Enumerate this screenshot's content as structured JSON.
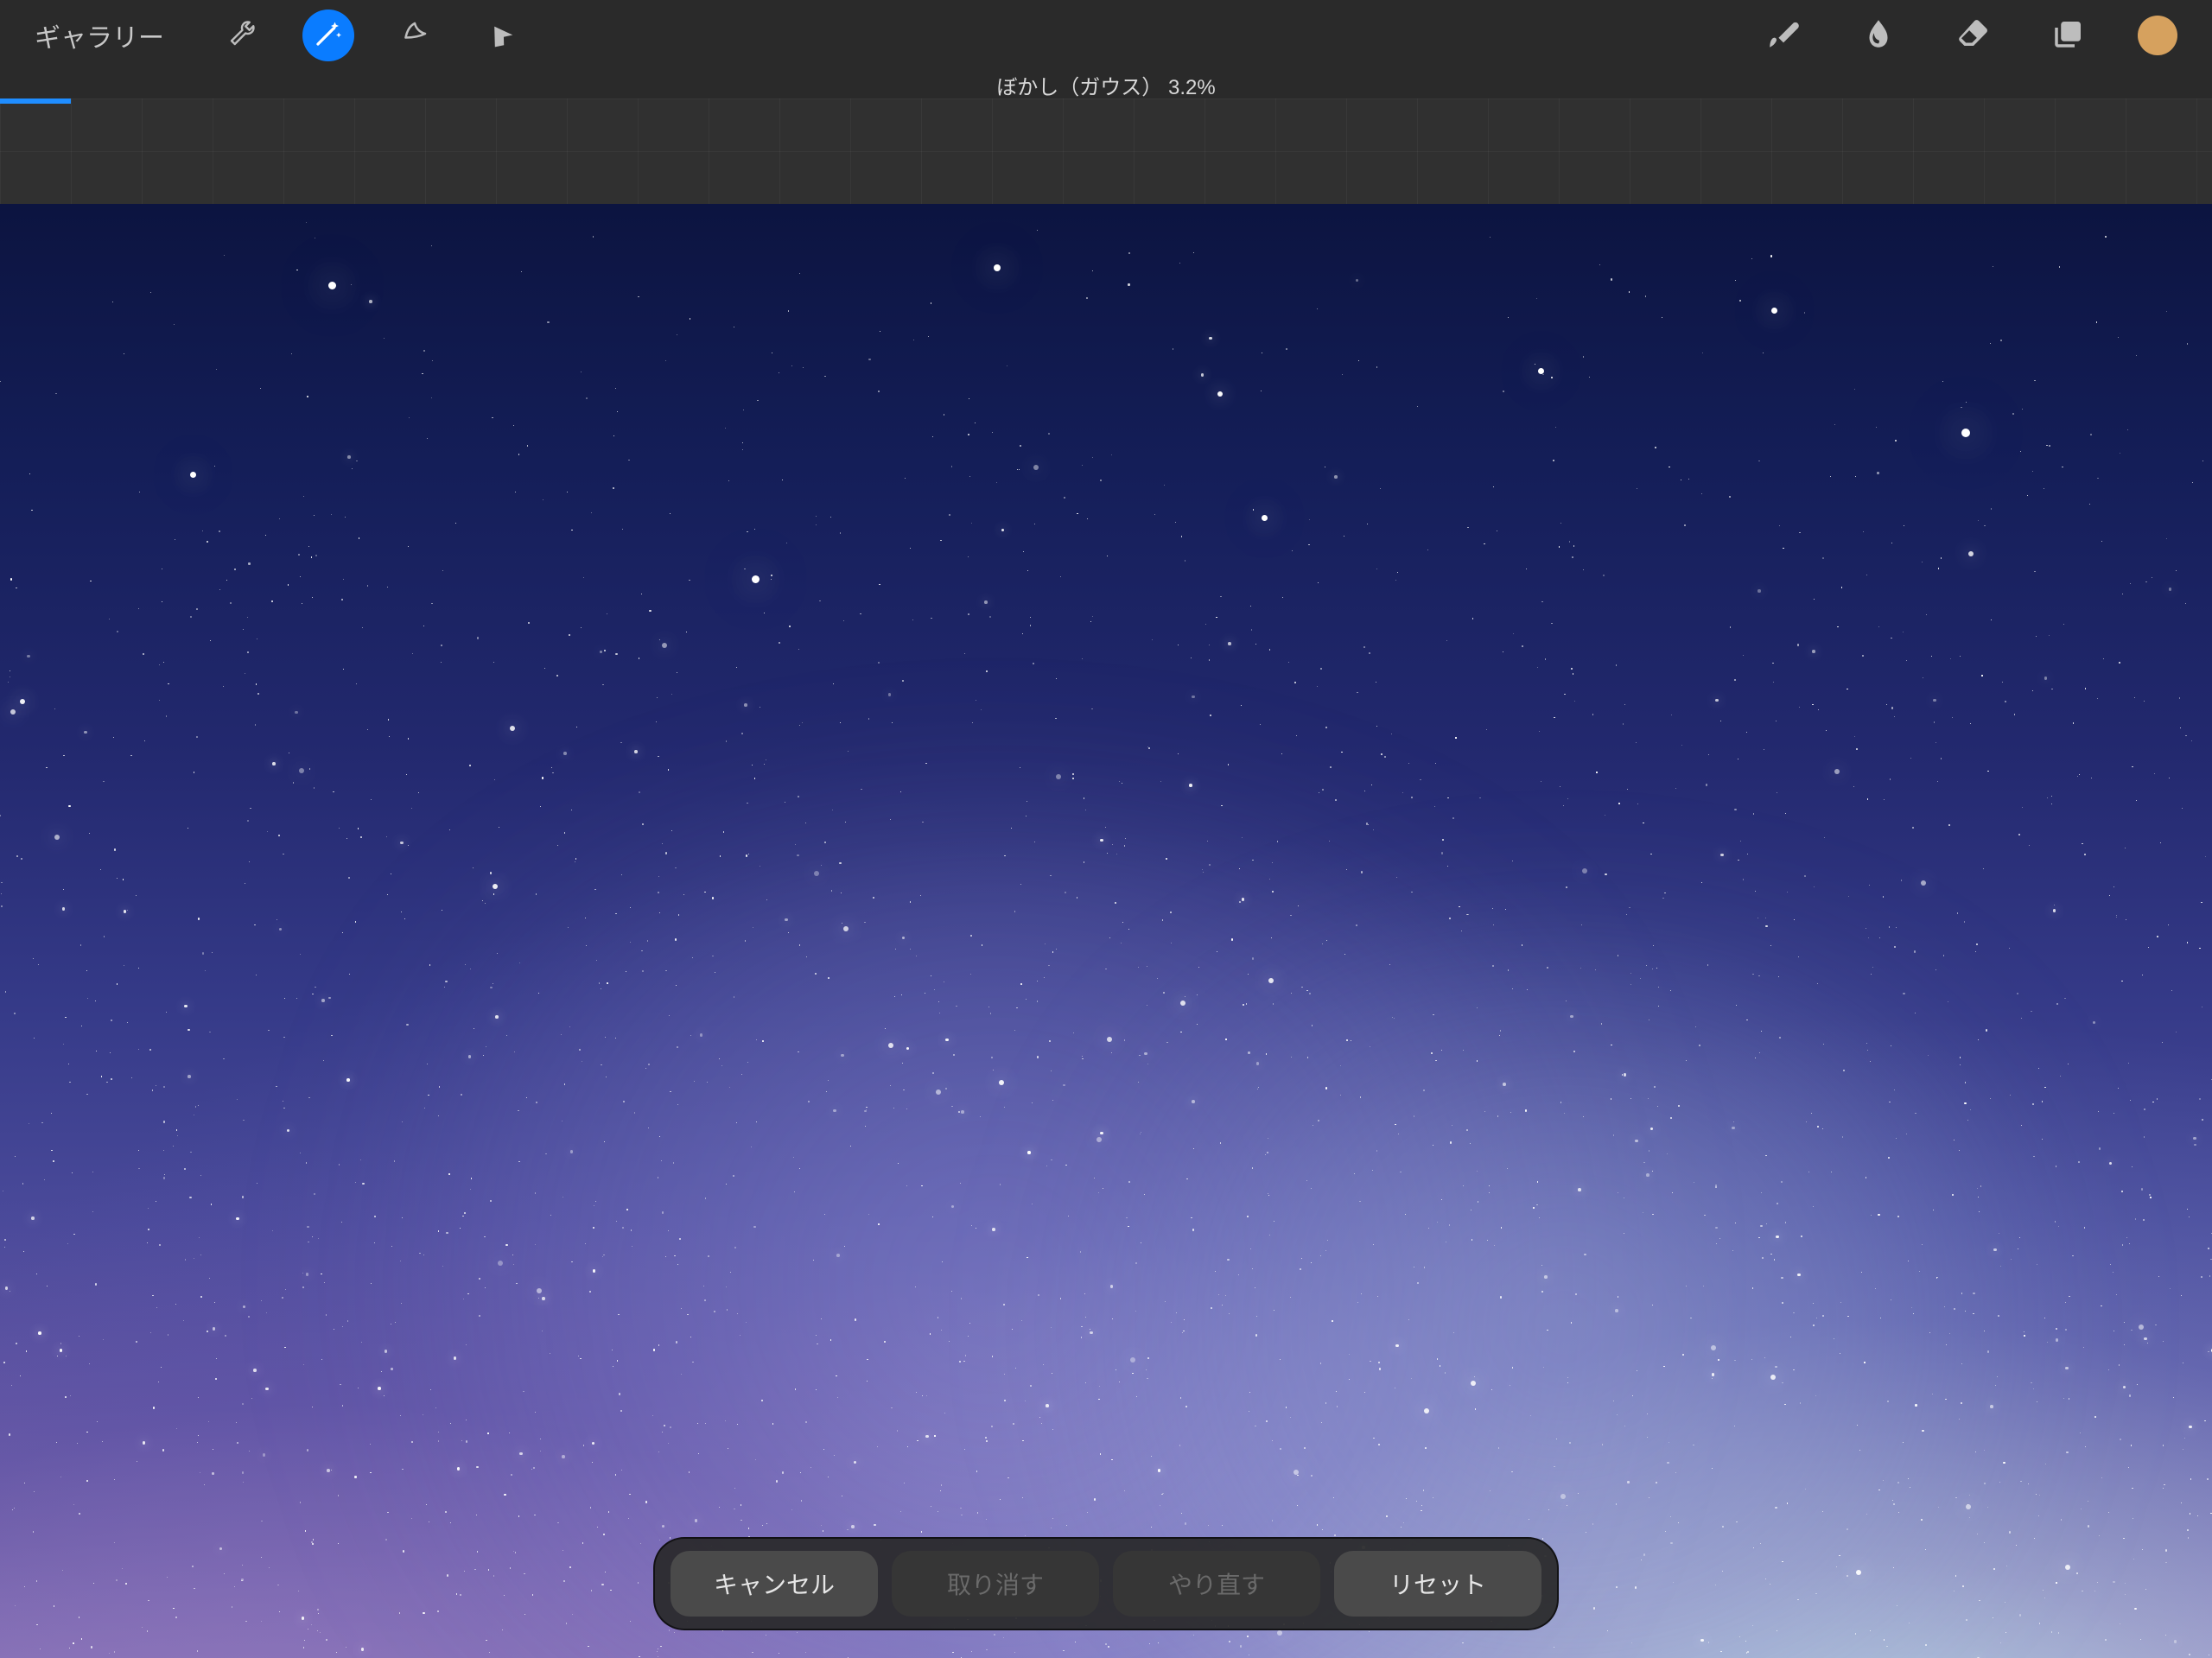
{
  "toolbar": {
    "gallery_label": "ギャラリー",
    "icons": {
      "wrench": "wrench-icon",
      "wand": "wand-icon",
      "select": "select-icon",
      "arrow": "arrow-icon",
      "brush": "brush-icon",
      "smudge": "smudge-icon",
      "eraser": "eraser-icon",
      "layers": "layers-icon"
    },
    "active_tool": "wand",
    "current_color": "#d6a15e"
  },
  "status": {
    "label": "ぼかし（ガウス）  3.2%",
    "effect_name": "ぼかし（ガウス）",
    "value_percent": 3.2
  },
  "slider": {
    "progress_percent": 3.2
  },
  "actions": {
    "cancel": "キャンセル",
    "undo": "取り消す",
    "redo": "やり直す",
    "reset": "リセット",
    "undo_enabled": false,
    "redo_enabled": false
  },
  "canvas": {
    "description": "starry-night-sky-artwork"
  }
}
